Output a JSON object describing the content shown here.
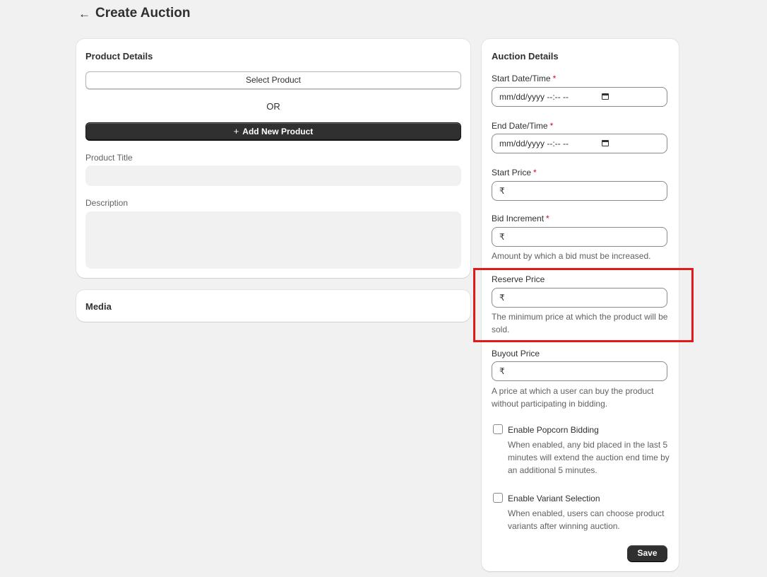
{
  "header": {
    "back_icon": "←",
    "title": "Create Auction"
  },
  "product_details": {
    "title": "Product Details",
    "select_product_label": "Select Product",
    "or_text": "OR",
    "add_new_product_label": "Add New Product",
    "plus_icon": "+",
    "product_title_label": "Product Title",
    "description_label": "Description"
  },
  "media": {
    "title": "Media"
  },
  "auction_details": {
    "title": "Auction Details",
    "required_mark": "*",
    "start_datetime_label": "Start Date/Time",
    "start_datetime_placeholder": "mm/dd/yyyy --:-- --",
    "end_datetime_label": "End Date/Time",
    "end_datetime_placeholder": "mm/dd/yyyy --:-- --",
    "start_price_label": "Start Price",
    "bid_increment_label": "Bid Increment",
    "bid_increment_help": "Amount by which a bid must be increased.",
    "reserve_price_label": "Reserve Price",
    "reserve_price_help": "The minimum price at which the product will be sold.",
    "buyout_price_label": "Buyout Price",
    "buyout_price_help": "A price at which a user can buy the product without participating in bidding.",
    "currency_symbol": "₹",
    "popcorn_label": "Enable Popcorn Bidding",
    "popcorn_help": "When enabled, any bid placed in the last 5 minutes will extend the auction end time by an additional 5 minutes.",
    "variant_label": "Enable Variant Selection",
    "variant_help": "When enabled, users can choose product variants after winning auction.",
    "save_label": "Save"
  },
  "colors": {
    "highlight": "#e01a1a",
    "primary_button": "#303030",
    "required": "#c70a24"
  }
}
